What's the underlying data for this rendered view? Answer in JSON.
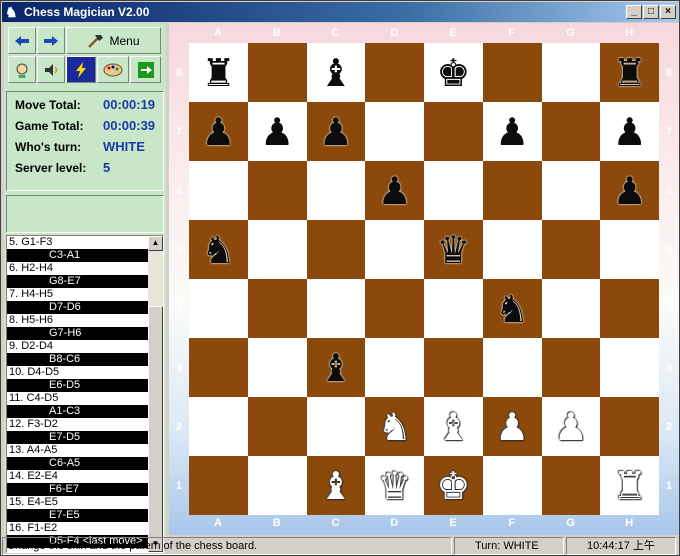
{
  "window": {
    "title": "Chess Magician  V2.00"
  },
  "toolbar": {
    "back": "back-arrow",
    "forward": "forward-arrow",
    "menu_label": "Menu",
    "tools": [
      "hint-icon",
      "sound-icon",
      "flash-icon",
      "skin-icon",
      "exit-icon"
    ]
  },
  "info": {
    "move_total_label": "Move  Total:",
    "move_total": "00:00:19",
    "game_total_label": "Game  Total:",
    "game_total": "00:00:39",
    "turn_label": "Who's turn:",
    "turn": "WHITE",
    "level_label": "Server level:",
    "level": "5"
  },
  "moves": [
    {
      "type": "w",
      "text": "5. G1-F3"
    },
    {
      "type": "b",
      "text": "C3-A1"
    },
    {
      "type": "w",
      "text": "6. H2-H4"
    },
    {
      "type": "b",
      "text": "G8-E7"
    },
    {
      "type": "w",
      "text": "7. H4-H5"
    },
    {
      "type": "b",
      "text": "D7-D6"
    },
    {
      "type": "w",
      "text": "8. H5-H6"
    },
    {
      "type": "b",
      "text": "G7-H6"
    },
    {
      "type": "w",
      "text": "9. D2-D4"
    },
    {
      "type": "b",
      "text": "B8-C6"
    },
    {
      "type": "w",
      "text": "10. D4-D5"
    },
    {
      "type": "b",
      "text": "E6-D5"
    },
    {
      "type": "w",
      "text": "11. C4-D5"
    },
    {
      "type": "b",
      "text": "A1-C3"
    },
    {
      "type": "w",
      "text": "12. F3-D2"
    },
    {
      "type": "b",
      "text": "E7-D5"
    },
    {
      "type": "w",
      "text": "13. A4-A5"
    },
    {
      "type": "b",
      "text": "C6-A5"
    },
    {
      "type": "w",
      "text": "14. E2-E4"
    },
    {
      "type": "b",
      "text": "F6-E7"
    },
    {
      "type": "w",
      "text": "15. E4-E5"
    },
    {
      "type": "b",
      "text": "E7-E5"
    },
    {
      "type": "w",
      "text": "16. F1-E2"
    },
    {
      "type": "b",
      "text": "D5-F4 <last move>"
    }
  ],
  "board": {
    "files": [
      "A",
      "B",
      "C",
      "D",
      "E",
      "F",
      "G",
      "H"
    ],
    "ranks": [
      "8",
      "7",
      "6",
      "5",
      "4",
      "3",
      "2",
      "1"
    ],
    "pieces": [
      {
        "square": "A8",
        "color": "black",
        "piece": "rook",
        "glyph": "♜"
      },
      {
        "square": "C8",
        "color": "black",
        "piece": "bishop",
        "glyph": "♝"
      },
      {
        "square": "E8",
        "color": "black",
        "piece": "king",
        "glyph": "♚"
      },
      {
        "square": "H8",
        "color": "black",
        "piece": "rook",
        "glyph": "♜"
      },
      {
        "square": "A7",
        "color": "black",
        "piece": "pawn",
        "glyph": "♟"
      },
      {
        "square": "B7",
        "color": "black",
        "piece": "pawn",
        "glyph": "♟"
      },
      {
        "square": "C7",
        "color": "black",
        "piece": "pawn",
        "glyph": "♟"
      },
      {
        "square": "F7",
        "color": "black",
        "piece": "pawn",
        "glyph": "♟"
      },
      {
        "square": "H7",
        "color": "black",
        "piece": "pawn",
        "glyph": "♟"
      },
      {
        "square": "D6",
        "color": "black",
        "piece": "pawn",
        "glyph": "♟"
      },
      {
        "square": "H6",
        "color": "black",
        "piece": "pawn",
        "glyph": "♟"
      },
      {
        "square": "A5",
        "color": "black",
        "piece": "knight",
        "glyph": "♞"
      },
      {
        "square": "E5",
        "color": "black",
        "piece": "queen",
        "glyph": "♛"
      },
      {
        "square": "F4",
        "color": "black",
        "piece": "knight",
        "glyph": "♞"
      },
      {
        "square": "C3",
        "color": "black",
        "piece": "bishop",
        "glyph": "♝"
      },
      {
        "square": "D2",
        "color": "white",
        "piece": "knight",
        "glyph": "♞"
      },
      {
        "square": "E2",
        "color": "white",
        "piece": "bishop",
        "glyph": "♝"
      },
      {
        "square": "F2",
        "color": "white",
        "piece": "pawn",
        "glyph": "♟"
      },
      {
        "square": "G2",
        "color": "white",
        "piece": "pawn",
        "glyph": "♟"
      },
      {
        "square": "C1",
        "color": "white",
        "piece": "bishop",
        "glyph": "♝"
      },
      {
        "square": "D1",
        "color": "white",
        "piece": "queen",
        "glyph": "♛"
      },
      {
        "square": "E1",
        "color": "white",
        "piece": "king",
        "glyph": "♚"
      },
      {
        "square": "H1",
        "color": "white",
        "piece": "rook",
        "glyph": "♜"
      }
    ]
  },
  "status": {
    "message": "Change the skin and the patern of the chess board.",
    "turn": "Turn: WHITE",
    "time": "10:44:17 上午"
  }
}
